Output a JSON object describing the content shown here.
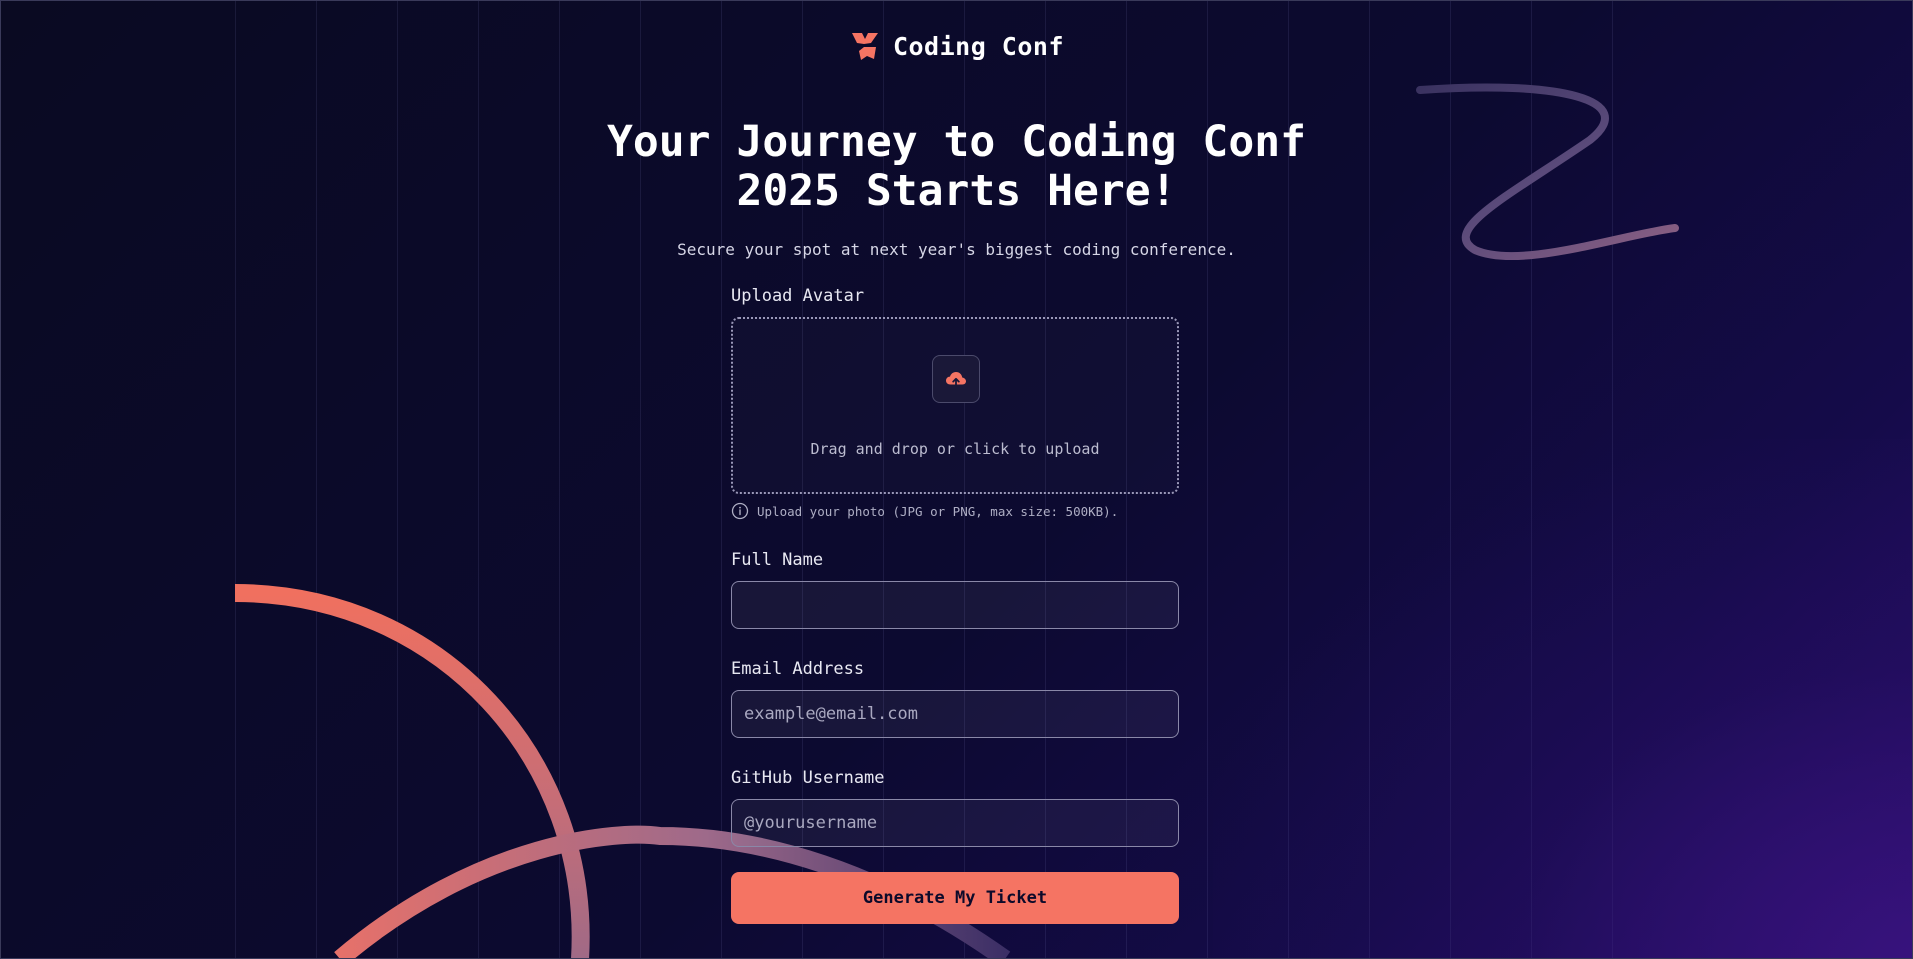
{
  "brand": {
    "name": "Coding Conf",
    "icon": "coding-conf-logo-icon"
  },
  "hero": {
    "title": "Your Journey to Coding Conf 2025 Starts Here!",
    "subtitle": "Secure your spot at next year's biggest coding conference."
  },
  "form": {
    "avatar": {
      "label": "Upload Avatar",
      "upload_text": "Drag and drop or click to upload",
      "upload_icon": "cloud-upload-icon",
      "hint": "Upload your photo (JPG or PNG, max size: 500KB).",
      "hint_icon": "info-icon"
    },
    "full_name": {
      "label": "Full Name",
      "value": "",
      "placeholder": ""
    },
    "email": {
      "label": "Email Address",
      "value": "",
      "placeholder": "example@email.com"
    },
    "github": {
      "label": "GitHub Username",
      "value": "",
      "placeholder": "@yourusername"
    },
    "submit_label": "Generate My Ticket"
  },
  "colors": {
    "accent": "#f57463",
    "background": "#0c0a2a",
    "text": "#ffffff"
  }
}
